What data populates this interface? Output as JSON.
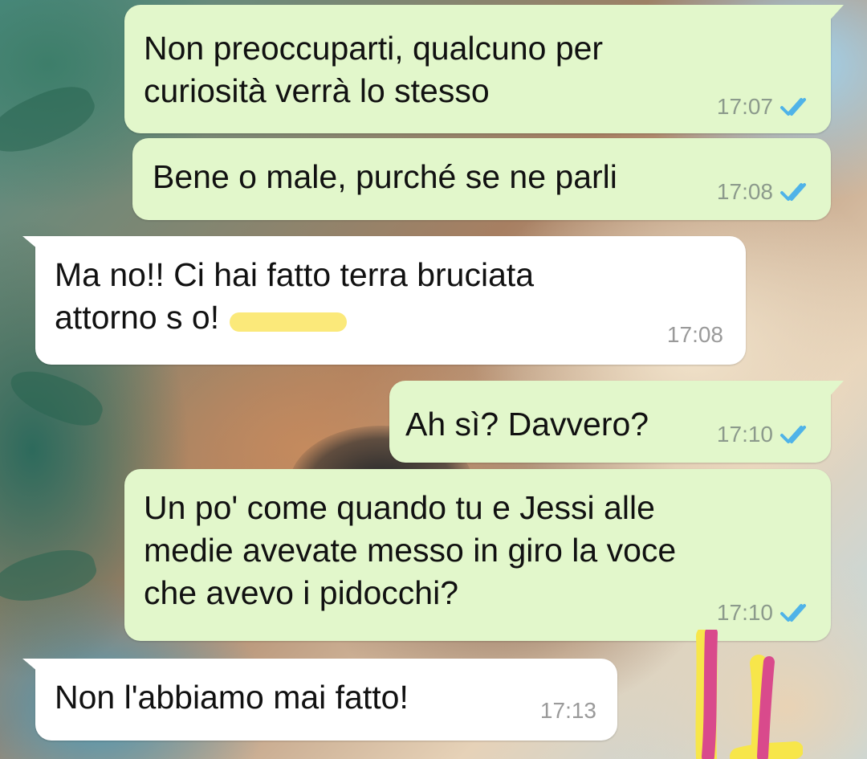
{
  "chat": {
    "messages": [
      {
        "direction": "outgoing",
        "text": "Non preoccuparti, qualcuno per\ncuriosità verrà lo stesso",
        "time": "17:07",
        "status": "read"
      },
      {
        "direction": "outgoing",
        "text": "Bene o male, purché se ne parli",
        "time": "17:08",
        "status": "read"
      },
      {
        "direction": "incoming",
        "text": "Ma no!! Ci hai fatto terra bruciata\nattorno s          o!",
        "time": "17:08",
        "redacted_word": true
      },
      {
        "direction": "outgoing",
        "text": "Ah sì? Davvero?",
        "time": "17:10",
        "status": "read"
      },
      {
        "direction": "outgoing",
        "text": "Un po' come quando tu e Jessi alle\nmedie avevate messo in giro la voce\nche avevo i pidocchi?",
        "time": "17:10",
        "status": "read"
      },
      {
        "direction": "incoming",
        "text": "Non l'abbiamo mai fatto!",
        "time": "17:13"
      }
    ]
  },
  "colors": {
    "outgoing_bubble": "#e2f7cb",
    "incoming_bubble": "#ffffff",
    "read_ticks": "#4fb3e8",
    "timestamp": "#8c9a8c",
    "redaction_highlight": "#fbe97a",
    "sticker_magenta": "#d94a8c",
    "sticker_yellow": "#f7e64a"
  },
  "icons": {
    "read_receipt": "double-check-icon",
    "sticker": "hand-drawn-sticker-icon"
  }
}
